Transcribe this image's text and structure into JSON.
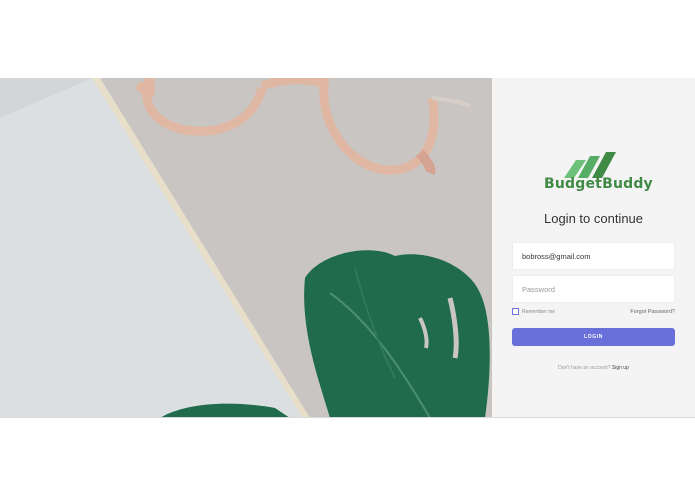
{
  "brand": {
    "name": "BudgetBuddy",
    "colors": {
      "light_green": "#6dc07a",
      "dark_green": "#3f8a45"
    }
  },
  "hero": {
    "icons": [
      "glasses-icon",
      "monstera-leaf-icon"
    ]
  },
  "login": {
    "heading": "Login to continue",
    "email_value": "bobross@gmail.com",
    "password_placeholder": "Password",
    "remember_label": "Remember me",
    "forgot_label": "Forgot Password?",
    "button_label": "LOGIN",
    "signup_prompt": "Don't have an account?",
    "signup_link": "Sign up",
    "accent_color": "#6a70d9"
  }
}
